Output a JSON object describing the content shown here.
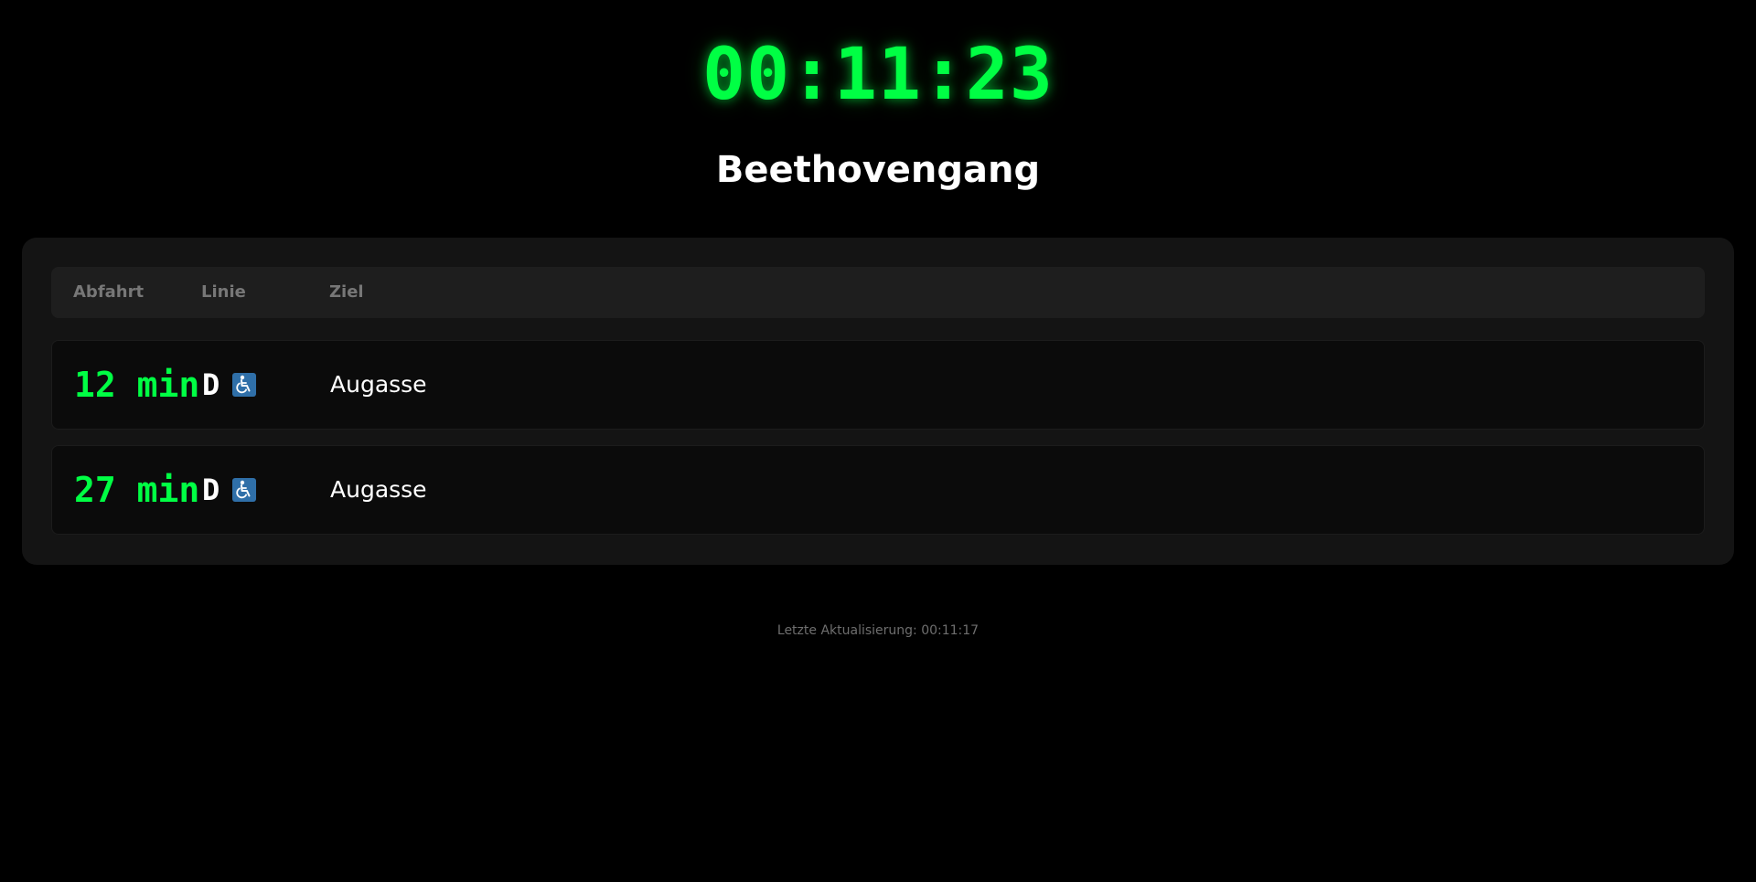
{
  "clock": "00:11:23",
  "station": "Beethovengang",
  "table": {
    "headers": [
      "Abfahrt",
      "Linie",
      "Ziel"
    ],
    "rows": [
      {
        "departure": "12 min",
        "line": "D",
        "accessible_icon": "wheelchair-icon",
        "destination": "Augasse"
      },
      {
        "departure": "27 min",
        "line": "D",
        "accessible_icon": "wheelchair-icon",
        "destination": "Augasse"
      }
    ]
  },
  "footer": {
    "last_update": "Letzte Aktualisierung: 00:11:17"
  },
  "colors": {
    "accent": "#00ff44",
    "background": "#000000",
    "panel": "#141414",
    "accessible_badge": "#2f6fa8"
  }
}
